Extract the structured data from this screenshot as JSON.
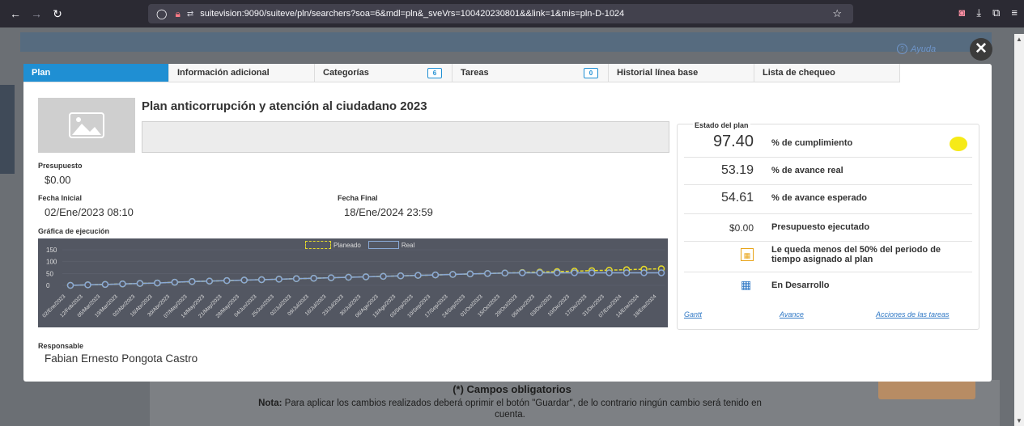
{
  "browser": {
    "url": "suitevision:9090/suiteve/pln/searchers?soa=6&mdl=pln&_sveVrs=100420230801&&link=1&mis=pln-D-1024",
    "icons": [
      "back-icon",
      "forward-icon",
      "reload-icon",
      "shield-icon",
      "lock-icon",
      "permissions-icon",
      "bookmark-star-icon",
      "pocket-icon",
      "download-icon",
      "extensions-icon",
      "menu-icon"
    ]
  },
  "help_label": "Ayuda",
  "tabs": [
    {
      "label": "Plan",
      "count": ""
    },
    {
      "label": "Información adicional",
      "count": ""
    },
    {
      "label": "Categorías",
      "count": "6"
    },
    {
      "label": "Tareas",
      "count": "0"
    },
    {
      "label": "Historial línea base",
      "count": ""
    },
    {
      "label": "Lista de chequeo",
      "count": ""
    }
  ],
  "plan": {
    "title": "Plan anticorrupción y atención al ciudadano 2023",
    "description": "",
    "budget_label": "Presupuesto",
    "budget": "$0.00",
    "start_label": "Fecha Inicial",
    "start": "02/Ene/2023 08:10",
    "end_label": "Fecha Final",
    "end": "18/Ene/2024 23:59",
    "chart_label": "Gráfica de ejecución",
    "responsible_label": "Responsable",
    "responsible": "Fabian Ernesto Pongota Castro"
  },
  "status": {
    "title": "Estado del plan",
    "compliance_value": "97.40",
    "compliance_label": "% de cumplimiento",
    "real_value": "53.19",
    "real_label": "% de avance real",
    "expected_value": "54.61",
    "expected_label": "% de avance esperado",
    "executed_value": "$0.00",
    "executed_label": "Presupuesto ejecutado",
    "time_msg": "Le queda menos del 50% del periodo de tiempo asignado al plan",
    "state": "En Desarrollo",
    "link_gantt": "Gantt",
    "link_avance": "Avance",
    "link_acciones": "Acciones de las tareas",
    "indicator_color": "#f6ea17"
  },
  "footer": {
    "required": "(*) Campos obligatorios",
    "note_bold": "Nota:",
    "note": "Para aplicar los cambios realizados deberá oprimir el botón \"Guardar\", de lo contrario ningún cambio será tenido en cuenta."
  },
  "chart_data": {
    "type": "line",
    "yticks": [
      "150",
      "100",
      "50",
      "0"
    ],
    "ylim": [
      0,
      150
    ],
    "legend": [
      "Planeado",
      "Real"
    ],
    "categories": [
      "02/Ene/2023",
      "12/Feb/2023",
      "05/Mar/2023",
      "19/Mar/2023",
      "02/Abr/2023",
      "16/Abr/2023",
      "30/Abr/2023",
      "07/May/2023",
      "14/May/2023",
      "21/May/2023",
      "28/May/2023",
      "04/Jun/2023",
      "25/Jun/2023",
      "02/Jul/2023",
      "09/Jul/2023",
      "16/Jul/2023",
      "23/Jul/2023",
      "30/Jul/2023",
      "06/Ago/2023",
      "13/Ago/2023",
      "03/Sep/2023",
      "10/Sep/2023",
      "17/Sep/2023",
      "24/Sep/2023",
      "01/Oct/2023",
      "15/Oct/2023",
      "29/Oct/2023",
      "05/Nov/2023",
      "03/Dic/2023",
      "10/Dic/2023",
      "17/Dic/2023",
      "31/Dic/2023",
      "07/Ene/2024",
      "14/Ene/2024",
      "18/Ene/2024"
    ],
    "series": [
      {
        "name": "Planeado",
        "color": "#e6db2a",
        "values": [
          0,
          2,
          4,
          6,
          8,
          10,
          13,
          16,
          18,
          20,
          22,
          24,
          26,
          28,
          30,
          32,
          34,
          36,
          38,
          40,
          42,
          44,
          46,
          48,
          50,
          52,
          54,
          56,
          58,
          60,
          62,
          64,
          66,
          68,
          70
        ]
      },
      {
        "name": "Real",
        "color": "#8aa9d6",
        "values": [
          0,
          2,
          4,
          6,
          8,
          10,
          13,
          16,
          18,
          20,
          22,
          24,
          26,
          28,
          30,
          32,
          34,
          36,
          38,
          40,
          42,
          44,
          46,
          48,
          50,
          52,
          53,
          53,
          53,
          53,
          53,
          53,
          53,
          53,
          53
        ]
      }
    ]
  }
}
